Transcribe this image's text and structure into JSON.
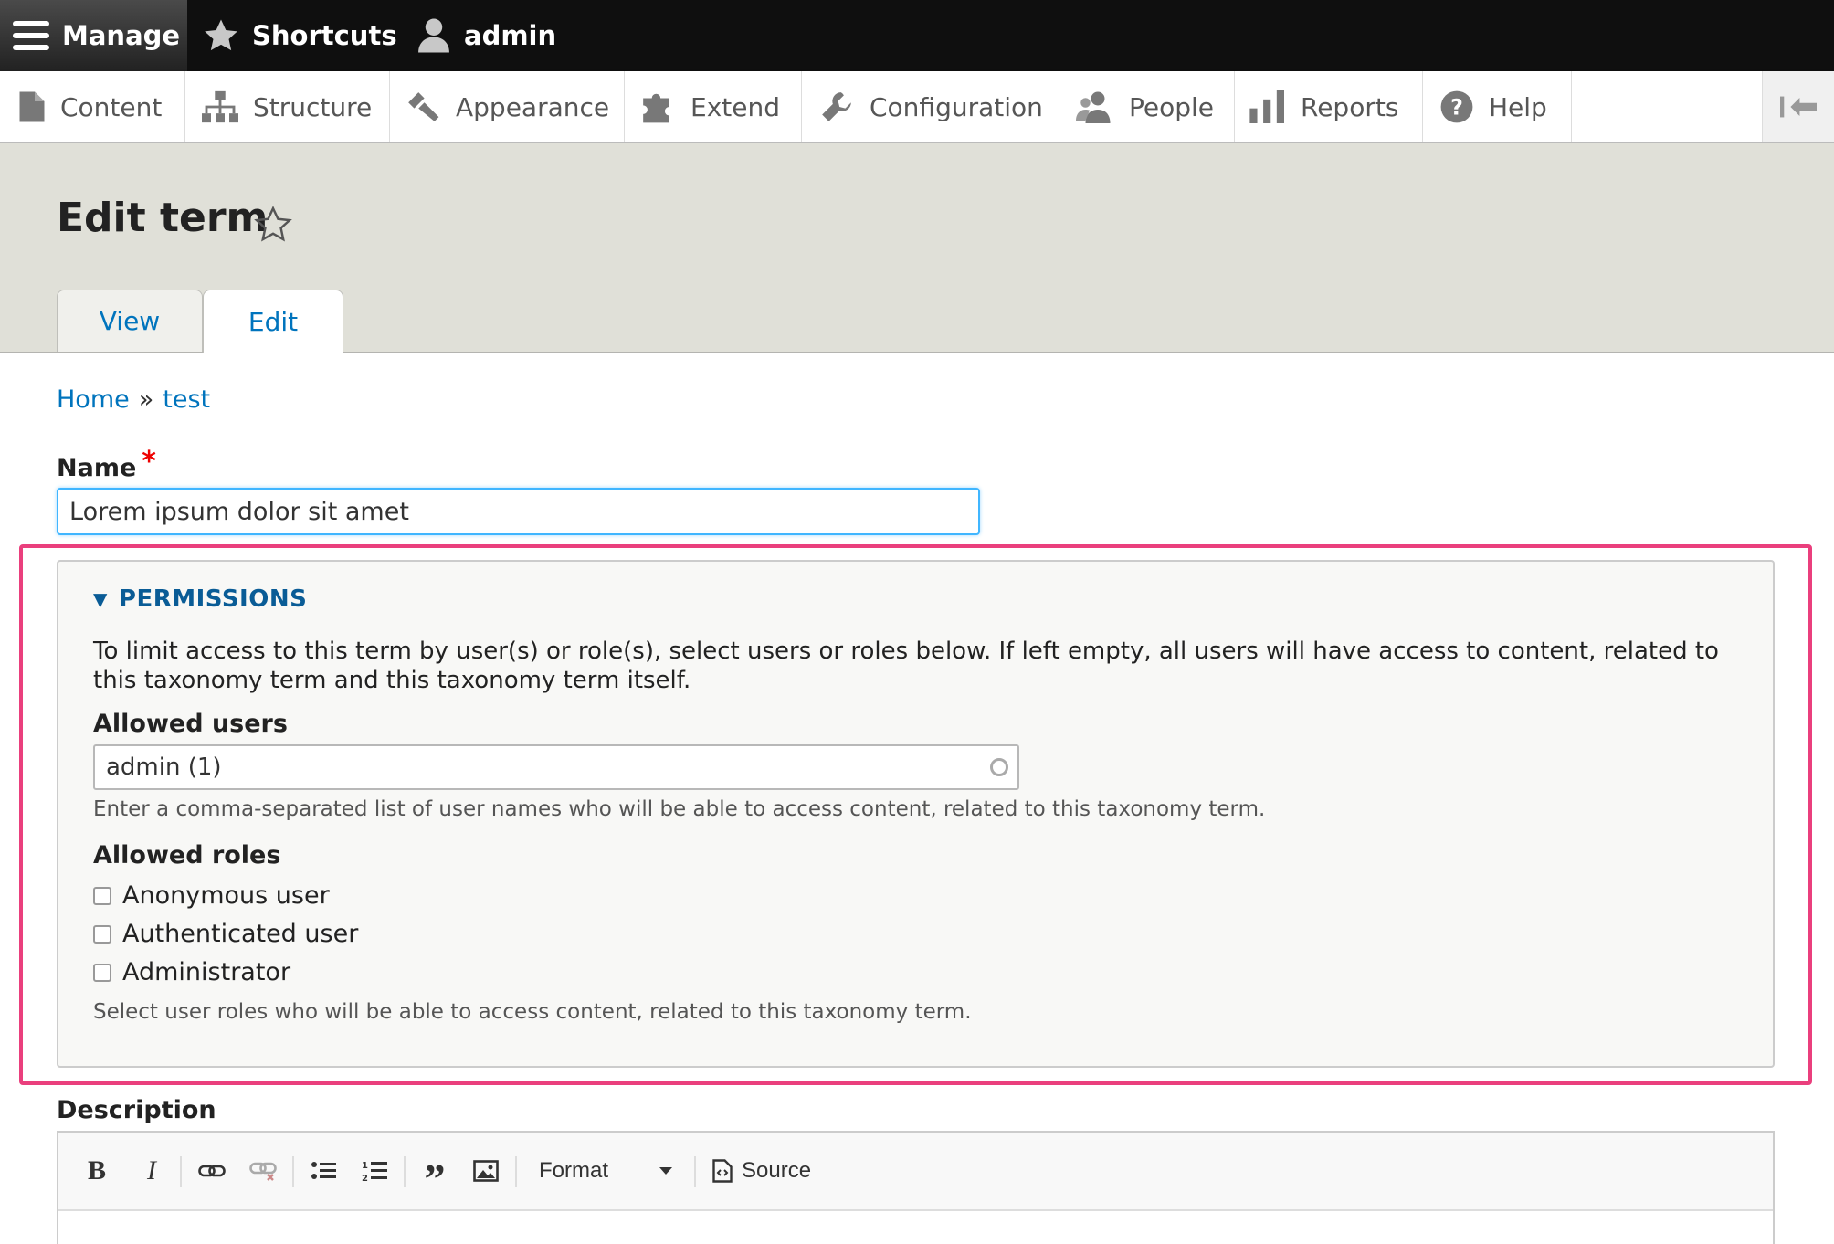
{
  "toolbar": {
    "manage_label": "Manage",
    "shortcuts_label": "Shortcuts",
    "user_label": "admin"
  },
  "admin_menu": {
    "items": [
      {
        "label": "Content",
        "icon": "file-icon"
      },
      {
        "label": "Structure",
        "icon": "sitemap-icon"
      },
      {
        "label": "Appearance",
        "icon": "paintbrush-icon"
      },
      {
        "label": "Extend",
        "icon": "puzzle-icon"
      },
      {
        "label": "Configuration",
        "icon": "wrench-icon"
      },
      {
        "label": "People",
        "icon": "people-icon"
      },
      {
        "label": "Reports",
        "icon": "bar-chart-icon"
      },
      {
        "label": "Help",
        "icon": "question-icon"
      }
    ]
  },
  "header": {
    "title": "Edit term",
    "tabs": [
      {
        "label": "View",
        "active": false
      },
      {
        "label": "Edit",
        "active": true
      }
    ]
  },
  "breadcrumb": {
    "home": "Home",
    "separator": "»",
    "current": "test"
  },
  "form": {
    "name_label": "Name",
    "required_marker": "*",
    "name_value": "Lorem ipsum dolor sit amet",
    "permissions": {
      "summary": "PERMISSIONS",
      "expanded": true,
      "description": "To limit access to this term by user(s) or role(s), select users or roles below. If left empty, all users will have access to content, related to this taxonomy term and this taxonomy term itself.",
      "allowed_users_label": "Allowed users",
      "allowed_users_value": "admin (1)",
      "allowed_users_help": "Enter a comma-separated list of user names who will be able to access content, related to this taxonomy term.",
      "allowed_roles_label": "Allowed roles",
      "roles": [
        {
          "label": "Anonymous user",
          "checked": false
        },
        {
          "label": "Authenticated user",
          "checked": false
        },
        {
          "label": "Administrator",
          "checked": false
        }
      ],
      "allowed_roles_help": "Select user roles who will be able to access content, related to this taxonomy term."
    },
    "description_label": "Description",
    "editor": {
      "format_label": "Format",
      "source_label": "Source"
    }
  },
  "colors": {
    "link": "#0074bd",
    "highlight": "#ea3f7d",
    "focus": "#40b6ff",
    "toolbar_bg": "#0f0f0f"
  }
}
